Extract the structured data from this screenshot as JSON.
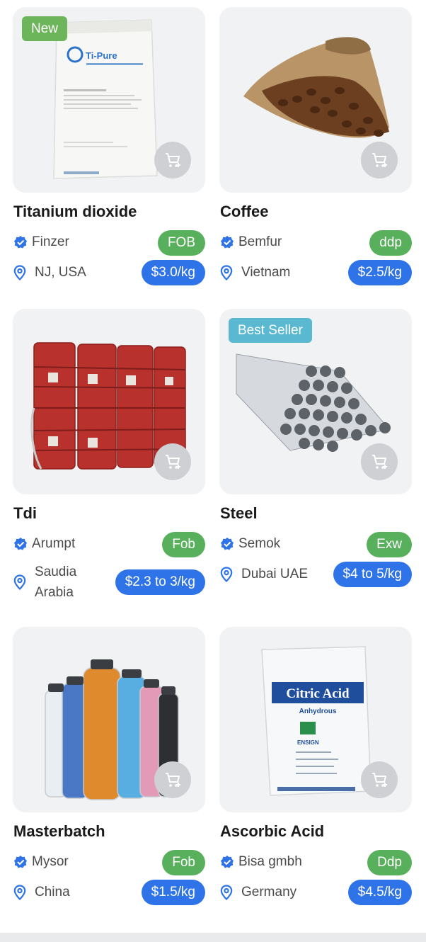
{
  "products": [
    {
      "title": "Titanium dioxide",
      "badge": "New",
      "seller": "Finzer",
      "terms": "FOB",
      "location": "NJ, USA",
      "price": "$3.0/kg",
      "image": "titanium-dioxide-bag"
    },
    {
      "title": "Coffee",
      "badge": "",
      "seller": "Bemfur",
      "terms": "ddp",
      "location": "Vietnam",
      "price": "$2.5/kg",
      "image": "coffee-sack"
    },
    {
      "title": "Tdi",
      "badge": "",
      "seller": "Arumpt",
      "terms": "Fob",
      "location_line1": "Saudia",
      "location_line2": "Arabia",
      "price": "$2.3 to 3/kg",
      "image": "red-drums"
    },
    {
      "title": "Steel",
      "badge": "Best Seller",
      "seller": "Semok",
      "terms": "Exw",
      "location": "Dubai UAE",
      "price": "$4 to 5/kg",
      "image": "steel-pipes"
    },
    {
      "title": "Masterbatch",
      "badge": "",
      "seller": "Mysor",
      "terms": "Fob",
      "location": "China",
      "price": "$1.5/kg",
      "image": "masterbatch-jars"
    },
    {
      "title": "Ascorbic Acid",
      "badge": "",
      "seller": "Bisa gmbh",
      "terms": "Ddp",
      "location": "Germany",
      "price": "$4.5/kg",
      "image": "citric-acid-bag",
      "bag_text": {
        "brand": "Citric Acid",
        "subtitle": "Anhydrous",
        "maker": "ENSIGN"
      }
    }
  ],
  "packaging_text": {
    "tipure": "Ti-Pure"
  },
  "colors": {
    "terms_green": "#59b05c",
    "price_blue": "#2f73e8",
    "badge_new": "#6cb55a",
    "badge_best": "#5ab8d0",
    "verified_blue": "#2f73e8"
  },
  "icons": {
    "cart": "add-to-cart-icon",
    "verified": "verified-badge-icon",
    "location": "location-pin-icon"
  }
}
